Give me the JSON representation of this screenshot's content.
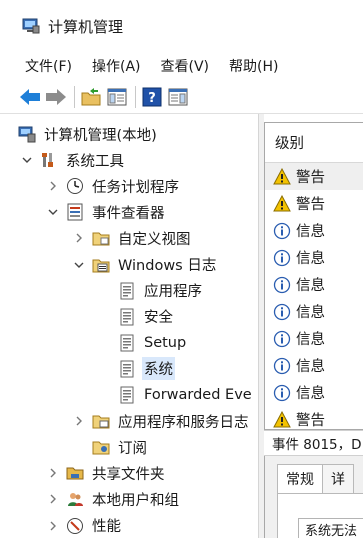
{
  "window": {
    "title": "计算机管理"
  },
  "menu": [
    {
      "label": "文件(F)"
    },
    {
      "label": "操作(A)"
    },
    {
      "label": "查看(V)"
    },
    {
      "label": "帮助(H)"
    }
  ],
  "toolbar": {
    "back_icon": "back-arrow-icon",
    "forward_icon": "forward-arrow-icon",
    "up_icon": "up-folder-icon",
    "show_tree_icon": "show-hide-tree-icon",
    "help_icon": "help-icon",
    "action_pane_icon": "show-hide-action-pane-icon"
  },
  "tree": [
    {
      "label": "计算机管理(本地)",
      "level": 0,
      "expander": "none",
      "icon": "computer-management-icon"
    },
    {
      "label": "系统工具",
      "level": 1,
      "expander": "expanded",
      "icon": "system-tools-icon"
    },
    {
      "label": "任务计划程序",
      "level": 2,
      "expander": "collapsed",
      "icon": "task-scheduler-icon"
    },
    {
      "label": "事件查看器",
      "level": 2,
      "expander": "expanded",
      "icon": "event-viewer-icon"
    },
    {
      "label": "自定义视图",
      "level": 3,
      "expander": "collapsed",
      "icon": "custom-views-folder-icon"
    },
    {
      "label": "Windows 日志",
      "level": 3,
      "expander": "expanded",
      "icon": "windows-logs-folder-icon"
    },
    {
      "label": "应用程序",
      "level": 4,
      "expander": "none",
      "icon": "log-icon"
    },
    {
      "label": "安全",
      "level": 4,
      "expander": "none",
      "icon": "log-icon"
    },
    {
      "label": "Setup",
      "level": 4,
      "expander": "none",
      "icon": "log-icon"
    },
    {
      "label": "系统",
      "level": 4,
      "expander": "none",
      "icon": "log-icon",
      "selected": true
    },
    {
      "label": "Forwarded Eve",
      "level": 4,
      "expander": "none",
      "icon": "log-icon"
    },
    {
      "label": "应用程序和服务日志",
      "level": 3,
      "expander": "collapsed",
      "icon": "app-services-logs-folder-icon"
    },
    {
      "label": "订阅",
      "level": 3,
      "expander": "none",
      "icon": "subscriptions-icon"
    },
    {
      "label": "共享文件夹",
      "level": 2,
      "expander": "collapsed",
      "icon": "shared-folders-icon"
    },
    {
      "label": "本地用户和组",
      "level": 2,
      "expander": "collapsed",
      "icon": "local-users-groups-icon"
    },
    {
      "label": "性能",
      "level": 2,
      "expander": "collapsed",
      "icon": "performance-icon"
    }
  ],
  "event_list": {
    "column_header": "级别",
    "rows": [
      {
        "level": "警告",
        "type": "warning"
      },
      {
        "level": "警告",
        "type": "warning"
      },
      {
        "level": "信息",
        "type": "info"
      },
      {
        "level": "信息",
        "type": "info"
      },
      {
        "level": "信息",
        "type": "info"
      },
      {
        "level": "信息",
        "type": "info"
      },
      {
        "level": "信息",
        "type": "info"
      },
      {
        "level": "信息",
        "type": "info"
      },
      {
        "level": "信息",
        "type": "info"
      },
      {
        "level": "警告",
        "type": "warning"
      }
    ]
  },
  "event_detail": {
    "heading": "事件 8015，D",
    "tabs": [
      {
        "label": "常规"
      },
      {
        "label": "详"
      }
    ],
    "general_text": "系统无法"
  },
  "colors": {
    "selection": "#d9e8fb",
    "warning": "#f3c200",
    "info_ring": "#2a5db0",
    "toolbar_blue": "#1e7fd8"
  }
}
